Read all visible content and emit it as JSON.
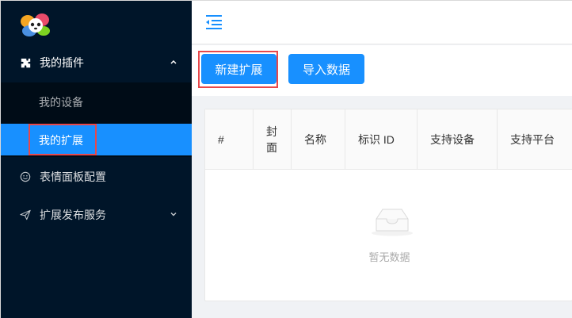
{
  "sidebar": {
    "plugins_label": "我的插件",
    "devices_label": "我的设备",
    "extensions_label": "我的扩展",
    "emoji_label": "表情面板配置",
    "publish_label": "扩展发布服务"
  },
  "toolbar": {
    "new_ext_label": "新建扩展",
    "import_label": "导入数据"
  },
  "table": {
    "col_index": "#",
    "col_cover": "封面",
    "col_name": "名称",
    "col_id": "标识 ID",
    "col_devices": "支持设备",
    "col_platform": "支持平台"
  },
  "empty_text": "暂无数据",
  "colors": {
    "accent": "#1890ff",
    "sidebar": "#001529",
    "highlight": "#e8484b"
  }
}
